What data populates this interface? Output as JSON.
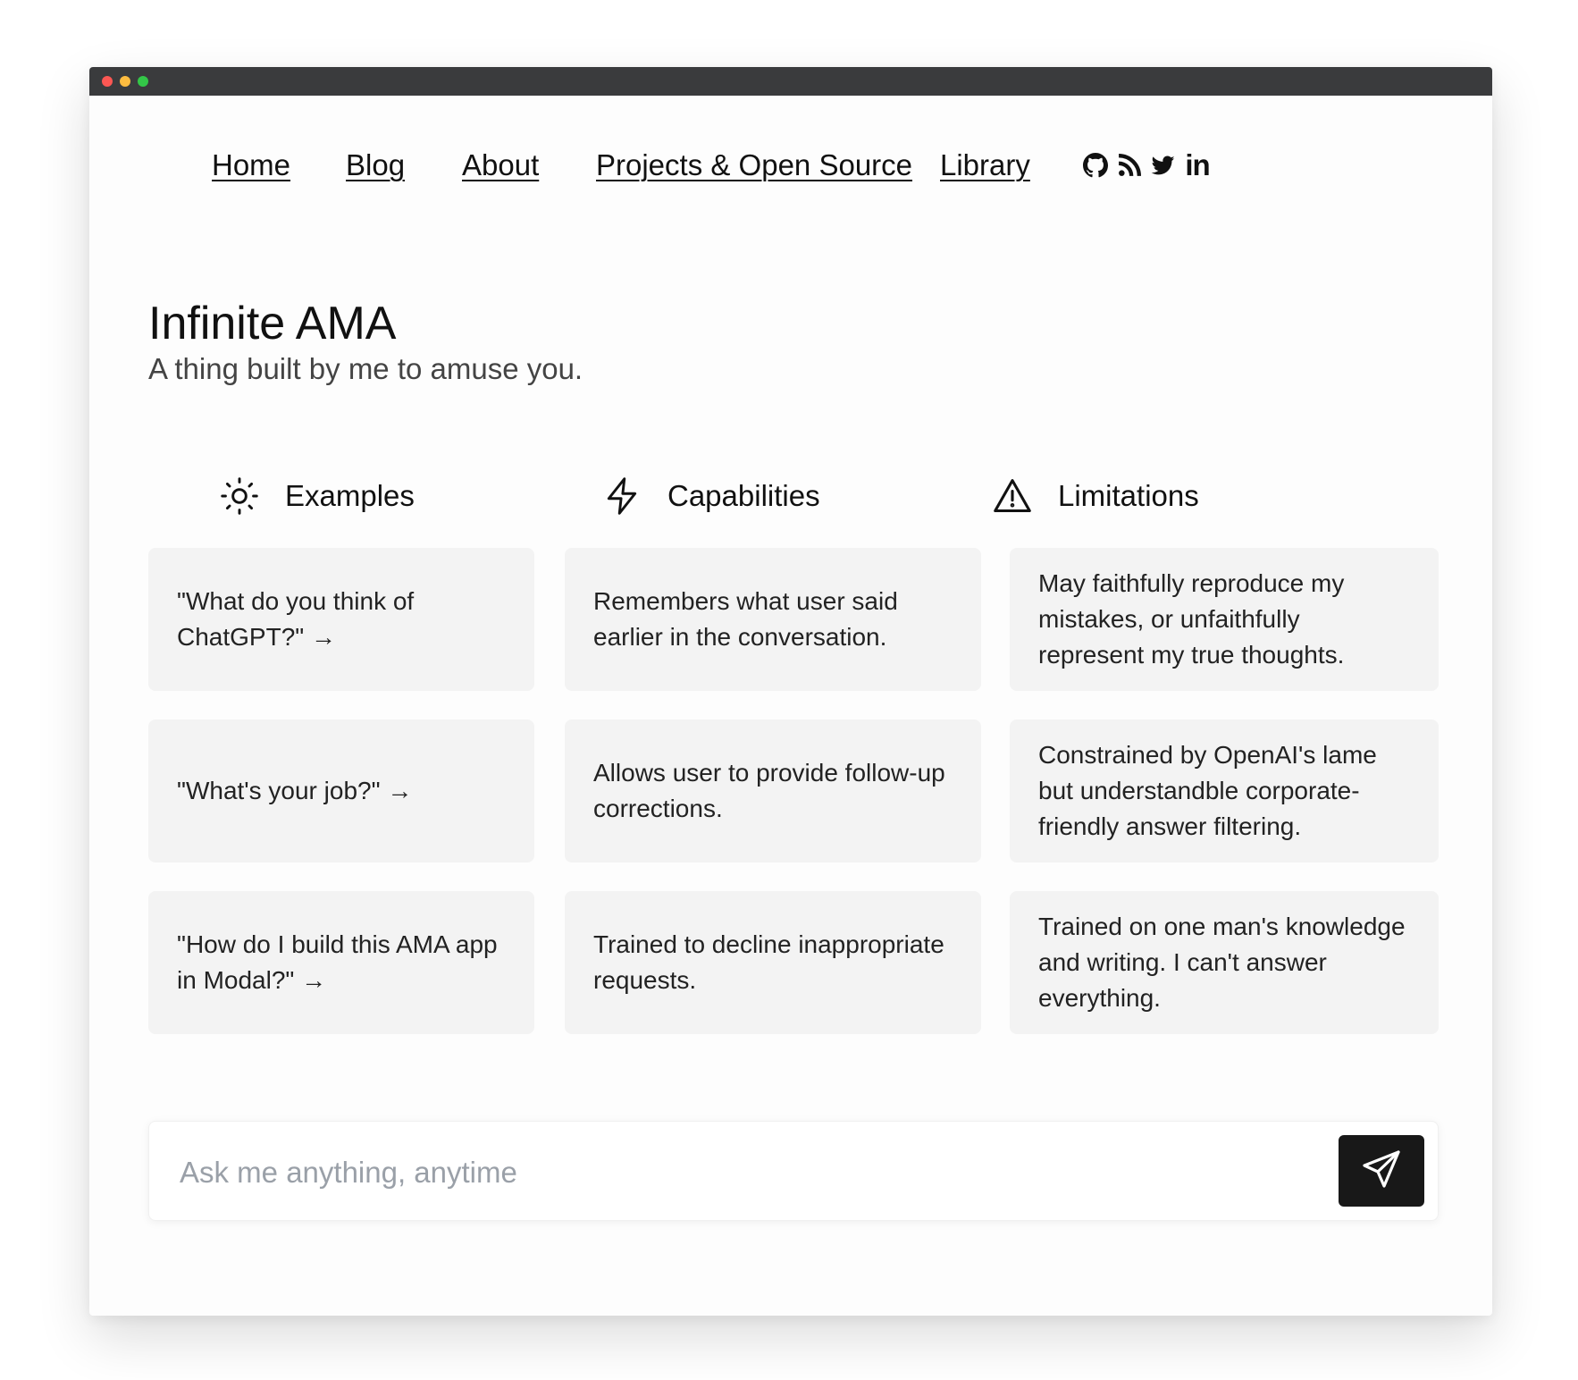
{
  "nav": {
    "links": [
      {
        "label": "Home"
      },
      {
        "label": "Blog"
      },
      {
        "label": "About"
      },
      {
        "label": "Projects & Open Source"
      },
      {
        "label": "Library"
      }
    ],
    "social_icons": [
      "github-icon",
      "rss-icon",
      "twitter-icon",
      "linkedin-icon"
    ],
    "linkedin_glyph": "in"
  },
  "hero": {
    "title": "Infinite AMA",
    "subtitle": "A thing built by me to amuse you."
  },
  "columns": [
    {
      "heading": "Examples",
      "icon": "sun-icon",
      "items": [
        "\"What do you think of ChatGPT?\" →",
        "\"What's your job?\" →",
        "\"How do I build this AMA app in Modal?\" →"
      ]
    },
    {
      "heading": "Capabilities",
      "icon": "lightning-icon",
      "items": [
        "Remembers what user said earlier in the conversation.",
        "Allows user to provide follow-up corrections.",
        "Trained to decline inappropriate requests."
      ]
    },
    {
      "heading": "Limitations",
      "icon": "warning-icon",
      "items": [
        "May faithfully reproduce my mistakes, or unfaithfully represent my true thoughts.",
        "Constrained by OpenAI's lame but understandble corporate-friendly answer filtering.",
        "Trained on one man's knowledge and writing. I can't answer everything."
      ]
    }
  ],
  "chat": {
    "placeholder": "Ask me anything, anytime",
    "value": "",
    "send_icon": "send-icon"
  },
  "colors": {
    "titlebar": "#3a3b3d",
    "card_bg": "#f3f3f3",
    "send_button_bg": "#181818",
    "placeholder": "#9aa0a8"
  }
}
